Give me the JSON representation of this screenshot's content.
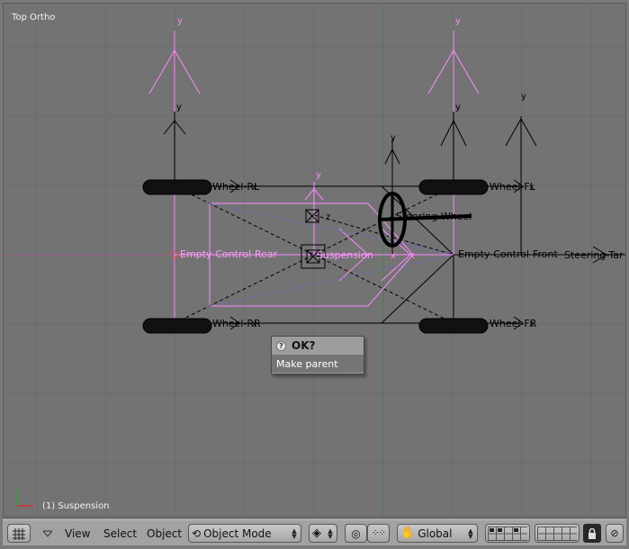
{
  "viewport": {
    "view_label": "Top Ortho",
    "status_label": "(1) Suspension",
    "axis_y": "y",
    "axis_x": "x",
    "axis_z": "z",
    "objects": {
      "empty_control_rear": "Empty-Control-Rear",
      "empty_control_front": "Empty-Control-Front",
      "suspension": "Suspension",
      "steering_wheel": "Steering-Wheel",
      "steering_target": "Steering-Tar",
      "wheel_front_left": "Wheel-FL",
      "wheel_front_right": "Wheel-FR",
      "wheel_rear_left": "Wheel-RL",
      "wheel_rear_right": "Wheel-RR"
    }
  },
  "popup": {
    "title": "OK?",
    "item": "Make parent",
    "icon": "question-icon"
  },
  "header": {
    "menus": [
      "View",
      "Select",
      "Object"
    ],
    "mode": "Object Mode",
    "transform_orientation": "Global"
  },
  "colors": {
    "background": "#737373",
    "grid": "#6a6a6a",
    "y_axis": "#3c8a3c",
    "x_axis": "#b0508b",
    "selected": "#ff88ff",
    "wire": "#000000"
  }
}
